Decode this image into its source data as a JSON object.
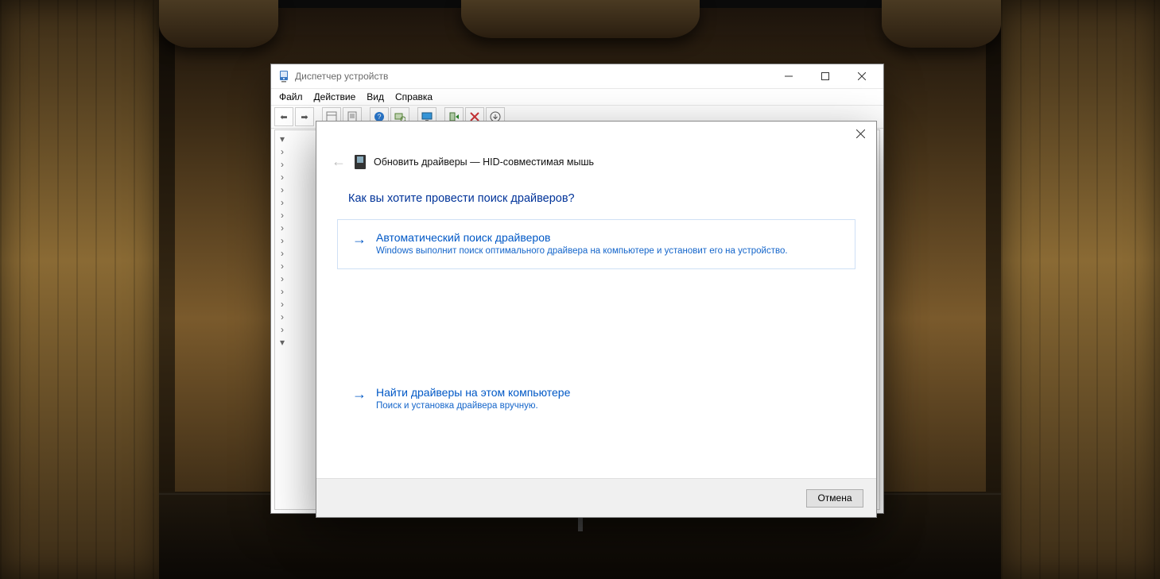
{
  "device_manager": {
    "title": "Диспетчер устройств",
    "menus": [
      "Файл",
      "Действие",
      "Вид",
      "Справка"
    ]
  },
  "wizard": {
    "header": "Обновить драйверы — HID-совместимая мышь",
    "question": "Как вы хотите провести поиск драйверов?",
    "options": [
      {
        "title": "Автоматический поиск драйверов",
        "desc": "Windows выполнит поиск оптимального драйвера на компьютере и установит его на устройство."
      },
      {
        "title": "Найти драйверы на этом компьютере",
        "desc": "Поиск и установка драйвера вручную."
      }
    ],
    "cancel": "Отмена"
  }
}
